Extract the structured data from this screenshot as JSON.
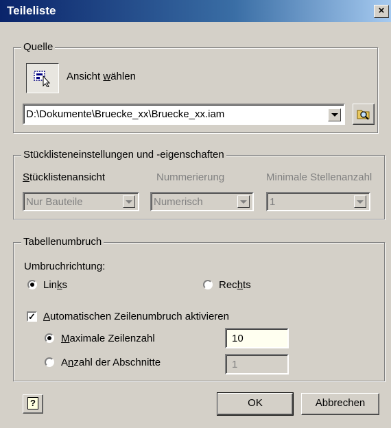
{
  "window": {
    "title": "Teileliste",
    "close_symbol": "×"
  },
  "quelle": {
    "legend": "Quelle",
    "view_button_label_pre": "Ansicht ",
    "view_button_label_u": "w",
    "view_button_label_post": "ählen",
    "file_path": "D:\\Dokumente\\Bruecke_xx\\Bruecke_xx.iam"
  },
  "stueckliste": {
    "legend": "Stücklisteneinstellungen und -eigenschaften",
    "col1_label_u": "S",
    "col1_label_rest": "tücklistenansicht",
    "col2_label": "Nummerierung",
    "col3_label": "Minimale Stellenanzahl",
    "col1_value": "Nur Bauteile",
    "col2_value": "Numerisch",
    "col3_value": "1"
  },
  "tabellenumbruch": {
    "legend": "Tabellenumbruch",
    "direction_label": "Umbruchrichtung:",
    "links_pre": "Lin",
    "links_u": "k",
    "links_post": "s",
    "rechts_pre": "Rec",
    "rechts_u": "h",
    "rechts_post": "ts",
    "auto_u": "A",
    "auto_rest": "utomatischen Zeilenumbruch aktivieren",
    "max_u": "M",
    "max_rest": "aximale Zeilenzahl",
    "max_value": "10",
    "anz_pre": "A",
    "anz_u": "n",
    "anz_post": "zahl der Abschnitte",
    "anz_value": "1"
  },
  "buttons": {
    "help": "?",
    "ok": "OK",
    "cancel": "Abbrechen"
  },
  "colors": {
    "titlebar_start": "#0a246a",
    "titlebar_end": "#a6caf0",
    "dialog_bg": "#d4d0c8"
  }
}
